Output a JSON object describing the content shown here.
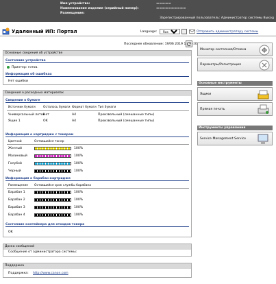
{
  "header": {
    "device_name_label": "Имя устройства:",
    "product_name_label": "Наименование изделия (серийный номер):",
    "location_label": "Размещение:",
    "user_text": "Зарегистрированный пользователь: Администратор системы Выход"
  },
  "titlebar": {
    "title": "Удаленный ИП: Портал",
    "language_label": "Language:",
    "language_value": "Russian",
    "mail_link": "Отправить администратору системы"
  },
  "refresh": {
    "text": "Последнее обновление: 19/06 2019 10:25:01"
  },
  "status": {
    "section_title": "Основные сведения об устройстве",
    "device_status_title": "Состояние устройства",
    "printer_status": "Принтер: готов.",
    "errors_title": "Информация об ошибках",
    "errors_value": "Нет ошибки"
  },
  "consumables": {
    "section_title": "Сведения о расходных материалах",
    "paper_title": "Сведения о бумаге",
    "paper_headers": [
      "Источник бумаги",
      "Осталось бумаги",
      "Формат бумаги",
      "Тип бумаги"
    ],
    "paper_rows": [
      [
        "Универсальный лоток",
        "Нет",
        "A4",
        "Произвольный (смешанные типы)"
      ],
      [
        "Ящик 1",
        "OK",
        "A4",
        "Произвольный (смешанные типы)"
      ]
    ],
    "toner_title": "Информация о картридже с тонером",
    "toner_headers": [
      "Цветной",
      "Оставшийся тонер"
    ],
    "toner": [
      {
        "name": "Желтый",
        "value": "100%",
        "level": 100
      },
      {
        "name": "Малиновый",
        "value": "100%",
        "level": 100
      },
      {
        "name": "Голубой",
        "value": "100%",
        "level": 100
      },
      {
        "name": "Черный",
        "value": "100%",
        "level": 100
      }
    ],
    "drum_title": "Информация о барабан-картридже",
    "drum_headers": [
      "Размещение",
      "Оставшийся срок службы барабана"
    ],
    "drums": [
      {
        "name": "Барабан 1",
        "value": "100%",
        "level": 100
      },
      {
        "name": "Барабан 2",
        "value": "100%",
        "level": 100
      },
      {
        "name": "Барабан 3",
        "value": "100%",
        "level": 100
      },
      {
        "name": "Барабан 4",
        "value": "100%",
        "level": 100
      }
    ],
    "waste_title": "Состояние контейнера для отходов тонера",
    "waste_value": "OK"
  },
  "messages": {
    "section_title": "Доска сообщений",
    "text": "Сообщение от администратора системы:"
  },
  "support": {
    "section_title": "Поддержка",
    "label": "Поддержка:",
    "link": "http://www.canon.com"
  },
  "right": {
    "monitor": "Монитор состояния/Отмена",
    "settings": "Параметры/Регистрация",
    "basic_tools": "Основные инструменты",
    "inbox": "Ящики",
    "direct_print": "Прямая печать",
    "mgmt_tools": "Инструменты управления",
    "sms": "Service Management Service"
  },
  "colors": {
    "yellow": "#f2e200",
    "magenta": "#d020c0",
    "cyan": "#21b8e8",
    "black": "#000000",
    "accent": "#1f3f8a"
  }
}
